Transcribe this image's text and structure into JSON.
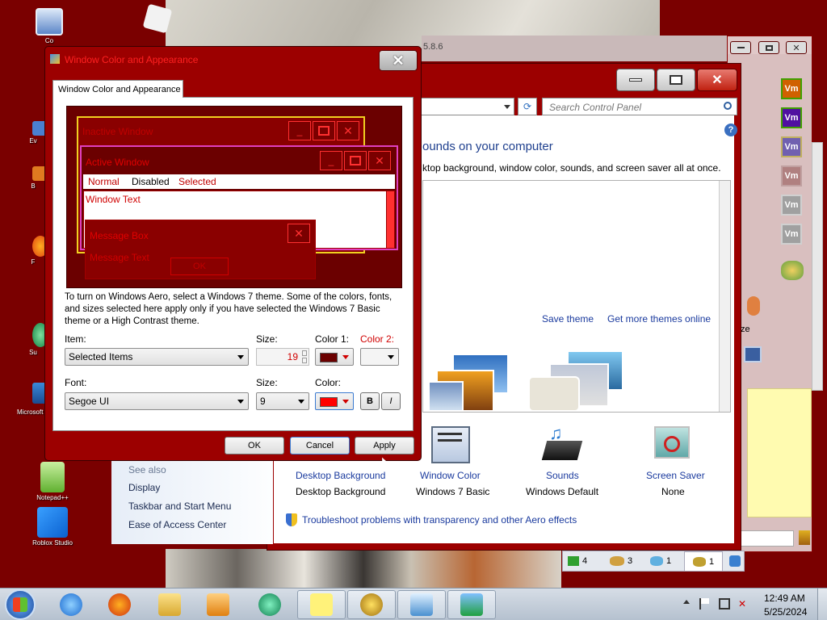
{
  "desktop": {
    "icons": [
      {
        "label": "Co"
      },
      {
        "label": "Ev"
      },
      {
        "label": "B"
      },
      {
        "label": "F"
      },
      {
        "label": "Su"
      },
      {
        "label": "Microsoft V"
      },
      {
        "label": "Notepad++"
      },
      {
        "label": "Roblox Studio"
      }
    ]
  },
  "background_window": {
    "version_text": "5.8.6"
  },
  "right_window": {
    "vm_badges": [
      "Vm",
      "Vm",
      "Vm",
      "Vm",
      "Vm",
      "Vm"
    ],
    "partial_text": "ze",
    "status_tabs": [
      {
        "count": "4"
      },
      {
        "count": "3"
      },
      {
        "count": "1"
      },
      {
        "count": "1"
      }
    ]
  },
  "control_panel": {
    "search_placeholder": "Search Control Panel",
    "heading": "ounds on your computer",
    "subheading": "ktop background, window color, sounds, and screen saver all at once.",
    "save_theme": "Save theme",
    "more_themes": "Get more themes online",
    "see_also_title": "See also",
    "see_also": [
      "Display",
      "Taskbar and Start Menu",
      "Ease of Access Center"
    ],
    "tiles": [
      {
        "title": "Desktop Background",
        "value": "Desktop Background"
      },
      {
        "title": "Window Color",
        "value": "Windows 7 Basic"
      },
      {
        "title": "Sounds",
        "value": "Windows Default"
      },
      {
        "title": "Screen Saver",
        "value": "None"
      }
    ],
    "troubleshoot": "Troubleshoot problems with transparency and other Aero effects"
  },
  "dialog": {
    "title": "Window Color and Appearance",
    "tab": "Window Color and Appearance",
    "preview": {
      "inactive": "Inactive Window",
      "active": "Active Window",
      "menu": [
        "Normal",
        "Disabled",
        "Selected"
      ],
      "window_text": "Window Text",
      "message_box": "Message Box",
      "message_text": "Message Text",
      "ok": "OK"
    },
    "description": "To turn on Windows Aero, select a Windows 7 theme.  Some of the colors, fonts, and sizes selected here apply only if you have selected the Windows 7 Basic theme or a High Contrast theme.",
    "item_label": "Item:",
    "item_value": "Selected Items",
    "size_label": "Size:",
    "size_value": "19",
    "color1_label": "Color 1:",
    "color2_label": "Color 2:",
    "font_label": "Font:",
    "font_value": "Segoe UI",
    "font_size_label": "Size:",
    "font_size_value": "9",
    "font_color_label": "Color:",
    "bold": "B",
    "italic": "I",
    "buttons": {
      "ok": "OK",
      "cancel": "Cancel",
      "apply": "Apply"
    },
    "colors": {
      "color1": "#6b0000",
      "font_color": "#ff0000"
    }
  },
  "taskbar": {
    "time": "12:49 AM",
    "date": "5/25/2024"
  },
  "colors": {
    "window_frame": "#9c0000",
    "desktop": "#7a0000",
    "accent_text": "#ff2020",
    "link": "#1a3a9e"
  }
}
